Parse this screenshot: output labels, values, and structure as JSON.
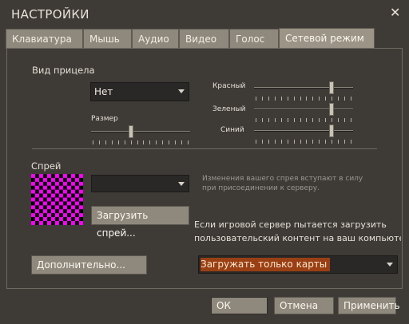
{
  "window": {
    "title": "НАСТРОЙКИ",
    "close_symbol": "✕"
  },
  "tabs": [
    {
      "label": "Клавиатура",
      "active": false
    },
    {
      "label": "Мышь",
      "active": false
    },
    {
      "label": "Аудио",
      "active": false
    },
    {
      "label": "Видео",
      "active": false
    },
    {
      "label": "Голос",
      "active": false
    },
    {
      "label": "Сетевой режим",
      "active": true
    }
  ],
  "crosshair": {
    "label": "Вид прицела",
    "selected": "Нет",
    "size_label": "Размер",
    "size_level": 0.5,
    "red_label": "Красный",
    "red_level": 1.0,
    "green_label": "Зеленый",
    "green_level": 1.0,
    "blue_label": "Синий",
    "blue_level": 1.0
  },
  "spray": {
    "label": "Спрей",
    "selected": "",
    "hint_line1": "Изменения вашего спрея вступают в силу",
    "hint_line2": "при присоединении к серверу.",
    "load_button": "Загрузить спрей...",
    "colors": {
      "primary": "#ff00ff",
      "secondary": "#000000"
    }
  },
  "custom_content": {
    "line1": "Если игровой сервер пытается загрузить",
    "line2": "пользовательский контент на ваш компьютер",
    "selected": "Загружать только карты"
  },
  "advanced_button": "Дополнительно...",
  "footer": {
    "ok": "ОК",
    "cancel": "Отмена",
    "apply": "Применить"
  }
}
